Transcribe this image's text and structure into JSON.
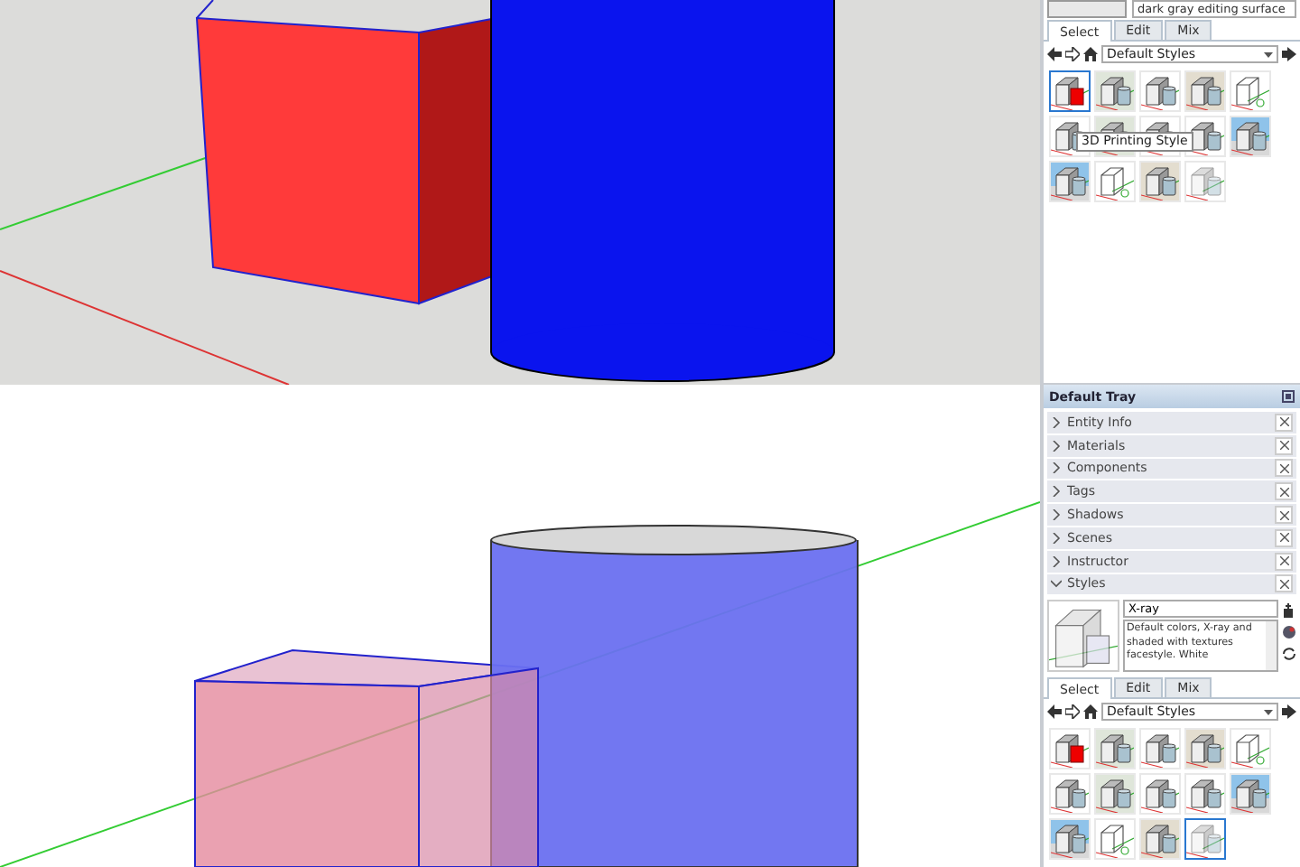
{
  "style_browser_top": {
    "style_description": "dark gray editing surface",
    "tabs": [
      {
        "label": "Select",
        "selected": true
      },
      {
        "label": "Edit",
        "selected": false
      },
      {
        "label": "Mix",
        "selected": false
      }
    ],
    "library": "Default Styles",
    "tooltip": "3D Printing Style",
    "styles": [
      {
        "kind": "red",
        "selected": true
      },
      {
        "kind": "green",
        "selected": false
      },
      {
        "kind": "white",
        "selected": false
      },
      {
        "kind": "tan",
        "selected": false
      },
      {
        "kind": "wire",
        "selected": false
      },
      {
        "kind": "white",
        "selected": false
      },
      {
        "kind": "green",
        "selected": false
      },
      {
        "kind": "white",
        "selected": false
      },
      {
        "kind": "white",
        "selected": false
      },
      {
        "kind": "sky",
        "selected": false
      },
      {
        "kind": "sky",
        "selected": false
      },
      {
        "kind": "wire",
        "selected": false
      },
      {
        "kind": "tan",
        "selected": false
      },
      {
        "kind": "xray",
        "selected": false
      }
    ]
  },
  "tray": {
    "title": "Default Tray",
    "panels": [
      {
        "label": "Entity Info",
        "expanded": false
      },
      {
        "label": "Materials",
        "expanded": false
      },
      {
        "label": "Components",
        "expanded": false
      },
      {
        "label": "Tags",
        "expanded": false
      },
      {
        "label": "Shadows",
        "expanded": false
      },
      {
        "label": "Scenes",
        "expanded": false
      },
      {
        "label": "Instructor",
        "expanded": false
      },
      {
        "label": "Styles",
        "expanded": true
      }
    ],
    "style_name": "X-ray",
    "style_description": "Default colors, X-ray and shaded with textures facestyle. White",
    "style_browser": {
      "tabs": [
        {
          "label": "Select",
          "selected": true
        },
        {
          "label": "Edit",
          "selected": false
        },
        {
          "label": "Mix",
          "selected": false
        }
      ],
      "library": "Default Styles",
      "styles": [
        {
          "kind": "red",
          "selected": false
        },
        {
          "kind": "green",
          "selected": false
        },
        {
          "kind": "white",
          "selected": false
        },
        {
          "kind": "tan",
          "selected": false
        },
        {
          "kind": "wire",
          "selected": false
        },
        {
          "kind": "white",
          "selected": false
        },
        {
          "kind": "green",
          "selected": false
        },
        {
          "kind": "white",
          "selected": false
        },
        {
          "kind": "white",
          "selected": false
        },
        {
          "kind": "sky",
          "selected": false
        },
        {
          "kind": "sky",
          "selected": false
        },
        {
          "kind": "wire",
          "selected": false
        },
        {
          "kind": "tan",
          "selected": false
        },
        {
          "kind": "xray",
          "selected": true
        }
      ]
    }
  }
}
